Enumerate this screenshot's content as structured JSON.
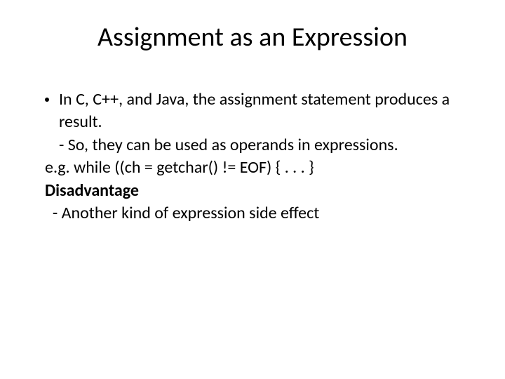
{
  "title": "Assignment as an Expression",
  "bullet1_line1": "In C, C++, and Java,  the assignment statement produces a result.",
  "bullet1_sub": "- So, they can be used as operands in expressions.",
  "example_line": "e.g.   while ((ch = getchar() != EOF) { . . . }",
  "disadvantage_label": "Disadvantage",
  "disadvantage_text": "  - Another kind of expression side effect"
}
